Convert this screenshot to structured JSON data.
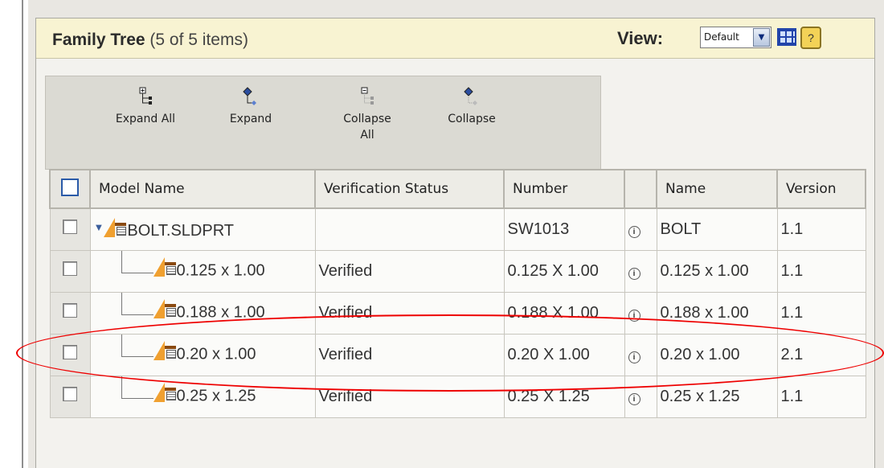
{
  "header": {
    "title": "Family Tree",
    "count": "(5 of 5 items)",
    "view_label": "View:",
    "view_value": "Default",
    "help_label": "?"
  },
  "toolbar": {
    "expand_all": "Expand All",
    "expand": "Expand",
    "collapse_all_line1": "Collapse",
    "collapse_all_line2": "All",
    "collapse": "Collapse"
  },
  "table": {
    "columns": [
      "Model Name",
      "Verification Status",
      "Number",
      "",
      "Name",
      "Version"
    ],
    "rows": [
      {
        "model": "BOLT.SLDPRT",
        "status": "",
        "number": "SW1013",
        "info": "i",
        "name": "BOLT",
        "version": "1.1"
      },
      {
        "model": "0.125 x 1.00",
        "status": "Verified",
        "number": "0.125 X 1.00",
        "info": "i",
        "name": "0.125 x 1.00",
        "version": "1.1"
      },
      {
        "model": "0.188 x 1.00",
        "status": "Verified",
        "number": "0.188 X 1.00",
        "info": "i",
        "name": "0.188 x 1.00",
        "version": "1.1"
      },
      {
        "model": "0.20 x 1.00",
        "status": "Verified",
        "number": "0.20 X 1.00",
        "info": "i",
        "name": "0.20 x 1.00",
        "version": "2.1"
      },
      {
        "model": "0.25 x 1.25",
        "status": "Verified",
        "number": "0.25 X 1.25",
        "info": "i",
        "name": "0.25 x 1.25",
        "version": "1.1"
      }
    ]
  },
  "colors": {
    "header_bg": "#f8f3d2",
    "toolbar_bg": "#dbdad3",
    "annotation_ring": "#e00000"
  },
  "icons": [
    "expand-all-icon",
    "expand-icon",
    "collapse-all-icon",
    "collapse-icon",
    "part-icon",
    "table-icon",
    "info-icon",
    "grid-view-icon"
  ]
}
